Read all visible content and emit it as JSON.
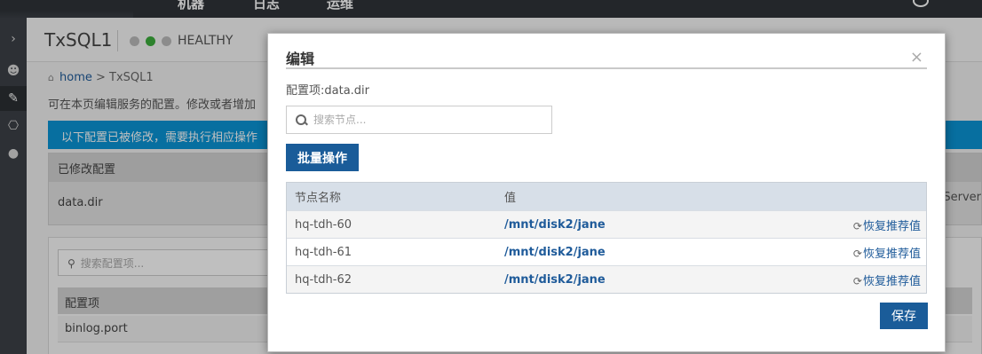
{
  "topnav": {
    "items": [
      "机器",
      "日志",
      "运维"
    ]
  },
  "rail": {
    "items": [
      {
        "icon": "chevron-right-icon",
        "glyph": "›"
      },
      {
        "icon": "mask-icon",
        "glyph": "☻"
      },
      {
        "icon": "tools-icon",
        "glyph": "✎"
      },
      {
        "icon": "mouse-icon",
        "glyph": "⎔"
      },
      {
        "icon": "user-icon",
        "glyph": "●"
      }
    ]
  },
  "service": {
    "name": "TxSQL1",
    "status": "HEALTHY"
  },
  "breadcrumb": {
    "home": "home",
    "separator": ">",
    "current": "TxSQL1"
  },
  "page": {
    "description": "可在本页编辑服务的配置。修改或者增加",
    "alert": "以下配置已被修改，需要执行相应操作",
    "modified_header": "已修改配置",
    "modified_item": "data.dir",
    "right_cut_text": "Server",
    "config_search_placeholder": "搜索配置项...",
    "config_header": "配置项",
    "config_row": "binlog.port"
  },
  "modal": {
    "title": "编辑",
    "close": "×",
    "config_item_label": "配置项:data.dir",
    "search_placeholder": "搜索节点...",
    "batch_button": "批量操作",
    "columns": [
      "节点名称",
      "值"
    ],
    "rows": [
      {
        "node": "hq-tdh-60",
        "value": "/mnt/disk2/jane",
        "action": "恢复推荐值"
      },
      {
        "node": "hq-tdh-61",
        "value": "/mnt/disk2/jane",
        "action": "恢复推荐值"
      },
      {
        "node": "hq-tdh-62",
        "value": "/mnt/disk2/jane",
        "action": "恢复推荐值"
      }
    ],
    "save_button": "保存"
  },
  "colors": {
    "primary_button": "#1a5c99",
    "alert": "#0a94d6",
    "link": "#1f5b9a",
    "health_green": "#3cae3c"
  }
}
